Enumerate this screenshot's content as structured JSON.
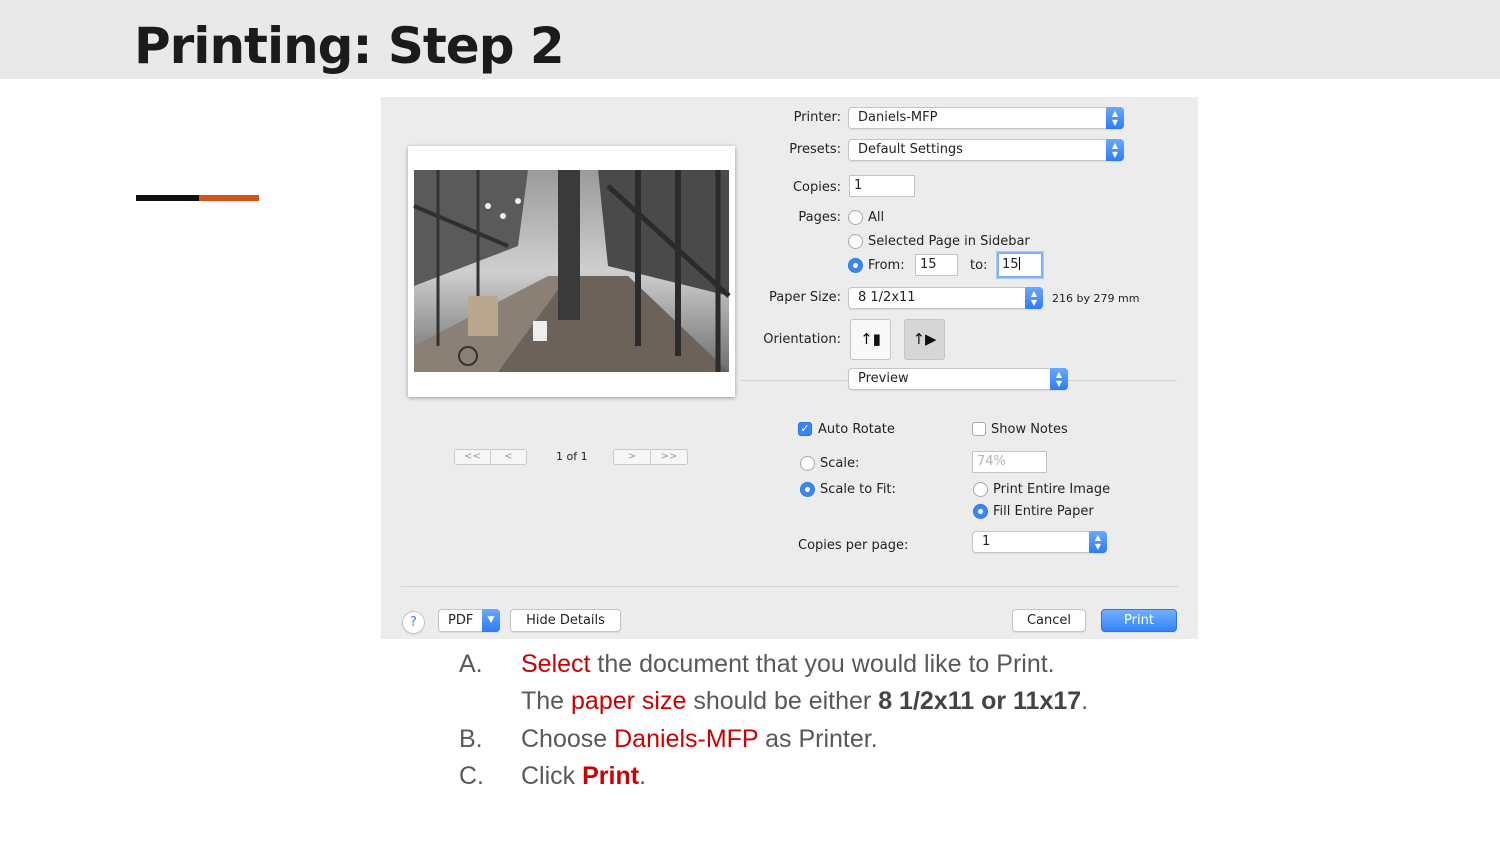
{
  "slide": {
    "title": "Printing: Step 2",
    "colors": {
      "accent_black": "#111111",
      "accent_orange": "#d2561c",
      "highlight_red": "#cc0000"
    }
  },
  "dialog": {
    "printer": {
      "label": "Printer:",
      "value": "Daniels-MFP"
    },
    "presets": {
      "label": "Presets:",
      "value": "Default Settings"
    },
    "copies": {
      "label": "Copies:",
      "value": "1"
    },
    "pages": {
      "label": "Pages:",
      "all_label": "All",
      "selected_label": "Selected Page in Sidebar",
      "from_label": "From:",
      "from_value": "15",
      "to_label": "to:",
      "to_value": "15",
      "selected_option": "From"
    },
    "paper_size": {
      "label": "Paper Size:",
      "value": "8 1/2x11",
      "dimensions": "216 by 279 mm"
    },
    "orientation": {
      "label": "Orientation:",
      "portrait_icon": "portrait-orientation-icon",
      "landscape_icon": "landscape-orientation-icon",
      "selected": "landscape"
    },
    "app_section": {
      "value": "Preview"
    },
    "auto_rotate": {
      "label": "Auto Rotate",
      "checked": true
    },
    "show_notes": {
      "label": "Show Notes",
      "checked": false
    },
    "scale": {
      "label": "Scale:",
      "value": "74%"
    },
    "scale_to_fit": {
      "label": "Scale to Fit:",
      "selected": true
    },
    "print_entire_image": {
      "label": "Print Entire Image",
      "selected": false
    },
    "fill_entire_paper": {
      "label": "Fill Entire Paper",
      "selected": true
    },
    "copies_per_page": {
      "label": "Copies per page:",
      "value": "1"
    },
    "pager": {
      "text": "1 of 1",
      "first": "<<",
      "prev": "<",
      "next": ">",
      "last": ">>"
    },
    "buttons": {
      "help": "?",
      "pdf": "PDF",
      "hide_details": "Hide Details",
      "cancel": "Cancel",
      "print": "Print"
    }
  },
  "steps": [
    {
      "letter": "A.",
      "pre": "",
      "highlight": "Select",
      "post": " the document that you would like to Print."
    },
    {
      "letter": "",
      "pre": "The ",
      "highlight": "paper size",
      "post": " should be either ",
      "bold": "8 1/2x11 or 11x17",
      "end": "."
    },
    {
      "letter": "B.",
      "pre": "Choose ",
      "highlight": "Daniels-MFP",
      "post": " as Printer."
    },
    {
      "letter": "C.",
      "pre": "Click ",
      "highlight": "Print",
      "post": "."
    }
  ]
}
